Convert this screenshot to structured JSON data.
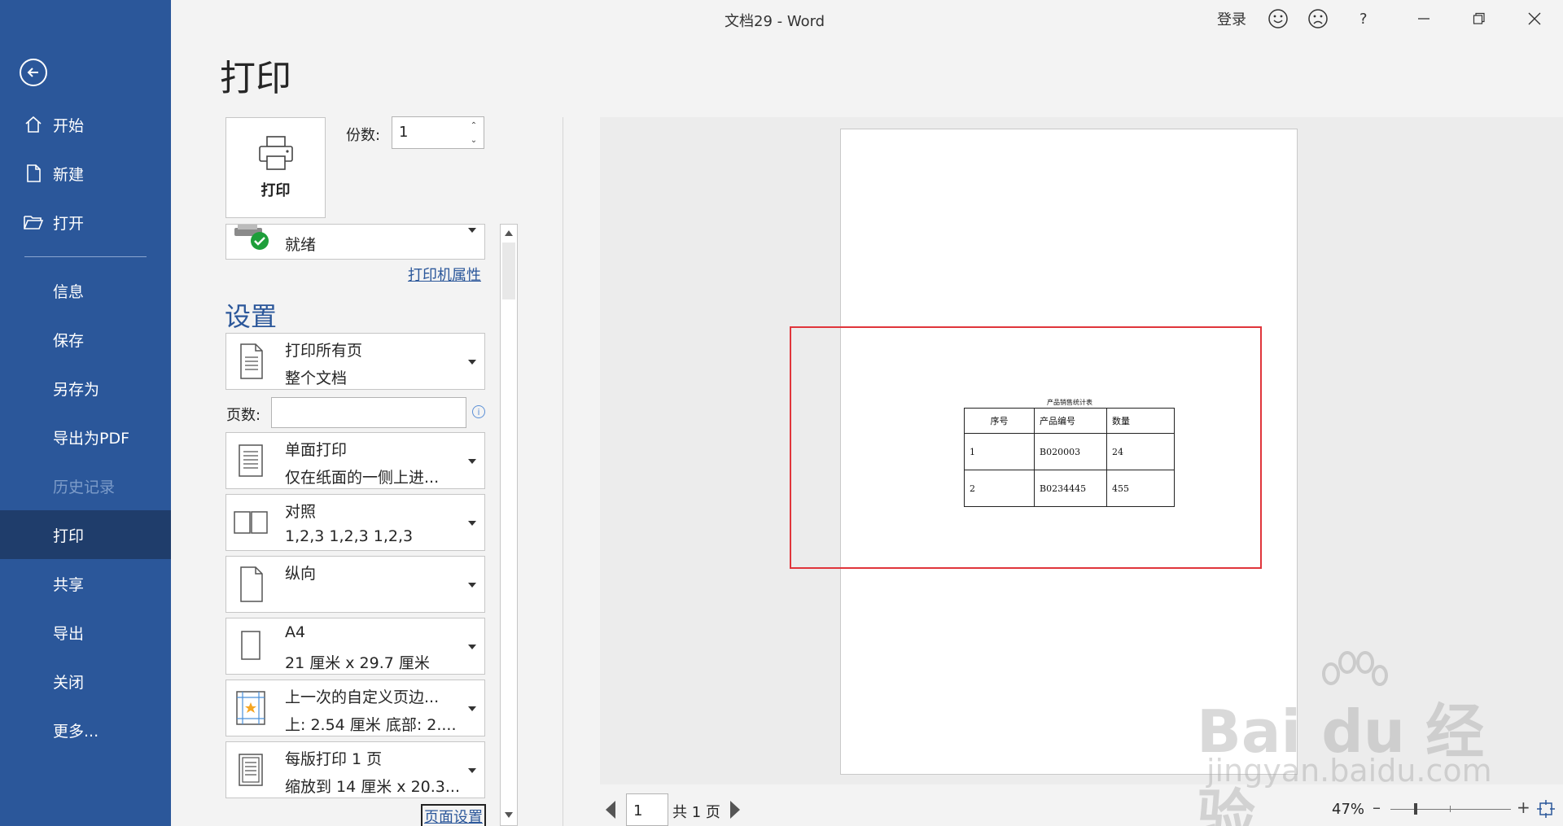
{
  "window": {
    "title": "文档29 - Word",
    "login": "登录",
    "help": "?"
  },
  "sidebar": {
    "items": [
      {
        "label": "开始"
      },
      {
        "label": "新建"
      },
      {
        "label": "打开"
      },
      {
        "label": "信息"
      },
      {
        "label": "保存"
      },
      {
        "label": "另存为"
      },
      {
        "label": "导出为PDF"
      },
      {
        "label": "历史记录"
      },
      {
        "label": "打印"
      },
      {
        "label": "共享"
      },
      {
        "label": "导出"
      },
      {
        "label": "关闭"
      },
      {
        "label": "更多..."
      }
    ],
    "active": "打印",
    "disabled": "历史记录"
  },
  "page": {
    "heading": "打印"
  },
  "print": {
    "button_label": "打印",
    "copies_label": "份数:",
    "copies_value": "1"
  },
  "printer": {
    "status": "就绪",
    "properties_link": "打印机属性"
  },
  "settings": {
    "title": "设置",
    "pages_label": "页数:",
    "pages_value": "",
    "options": [
      {
        "line1": "打印所有页",
        "line2": "整个文档"
      },
      {
        "line1": "单面打印",
        "line2": "仅在纸面的一侧上进..."
      },
      {
        "line1": "对照",
        "line2": "1,2,3    1,2,3    1,2,3"
      },
      {
        "line1": "纵向",
        "line2": ""
      },
      {
        "line1": "A4",
        "line2": "21 厘米 x 29.7 厘米"
      },
      {
        "line1": "上一次的自定义页边...",
        "line2": "上: 2.54 厘米 底部: 2...."
      },
      {
        "line1": "每版打印 1 页",
        "line2": "缩放到 14 厘米 x 20.3..."
      }
    ],
    "page_setup_link": "页面设置"
  },
  "preview": {
    "table_caption": "产品销售统计表",
    "headers": [
      "序号",
      "产品编号",
      "数量"
    ],
    "rows": [
      [
        "1",
        "B020003",
        "24"
      ],
      [
        "2",
        "B0234445",
        "455"
      ]
    ]
  },
  "footer": {
    "current_page": "1",
    "total_pages": "共 1 页",
    "zoom": "47%",
    "zoom_level": 47
  },
  "watermark": {
    "main": "Bai du 经验",
    "sub": "jingyan.baidu.com"
  }
}
